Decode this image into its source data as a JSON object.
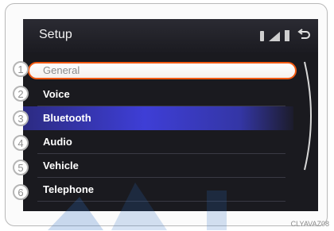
{
  "header": {
    "title": "Setup"
  },
  "status_icons": [
    "bluetooth-icon",
    "signal-icon",
    "battery-icon",
    "back-icon"
  ],
  "menu": {
    "items": [
      {
        "number": "1",
        "label": "General"
      },
      {
        "number": "2",
        "label": "Voice"
      },
      {
        "number": "3",
        "label": "Bluetooth"
      },
      {
        "number": "4",
        "label": "Audio"
      },
      {
        "number": "5",
        "label": "Vehicle"
      },
      {
        "number": "6",
        "label": "Telephone"
      }
    ]
  },
  "image_code": "CLYAVAZ08",
  "colors": {
    "selection_border": "#f35a12",
    "highlight": "#3e3ed6",
    "screen_bg": "#1a1a1f",
    "callout": "#b5b5b5"
  }
}
